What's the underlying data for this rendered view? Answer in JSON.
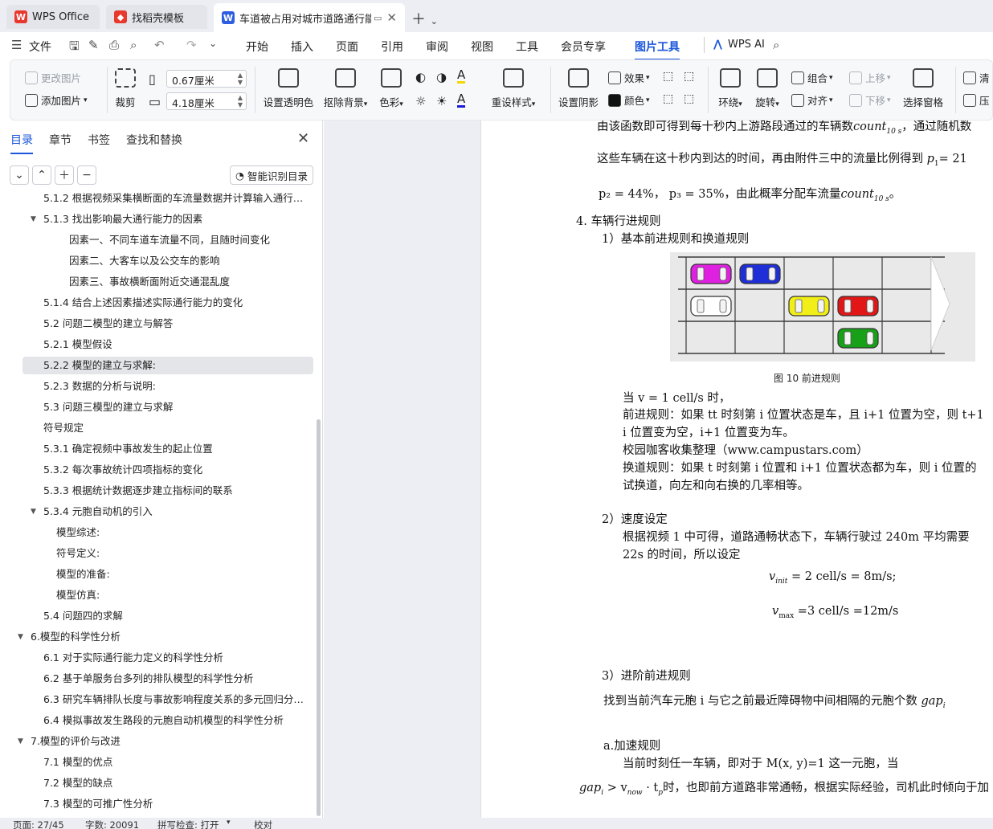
{
  "tabs": [
    {
      "label": "WPS Office",
      "icon": "wps-logo-icon",
      "color": "#e8392f"
    },
    {
      "label": "找稻壳模板",
      "icon": "docer-icon",
      "color": "#e8392f"
    },
    {
      "label": "车道被占用对城市道路通行能",
      "icon": "writer-doc-icon",
      "color": "#2f5fe0"
    }
  ],
  "menu": {
    "file": "文件",
    "items": [
      "开始",
      "插入",
      "页面",
      "引用",
      "审阅",
      "视图",
      "工具",
      "会员专享",
      "图片工具"
    ],
    "active": "图片工具",
    "wps_ai": "WPS AI"
  },
  "ribbon": {
    "change_image": "更改图片",
    "add_image": "添加图片",
    "crop": "裁剪",
    "width_value": "0.67厘米",
    "height_value": "4.18厘米",
    "set_transparent": "设置透明色",
    "remove_bg": "抠除背景",
    "color_tone": "色彩",
    "reset_style": "重设样式",
    "set_shadow": "设置阴影",
    "effects": "效果",
    "color": "颜色",
    "wrap": "环绕",
    "rotate": "旋转",
    "group": "组合",
    "align": "对齐",
    "move_up": "上移",
    "move_down": "下移",
    "select_pane": "选择窗格",
    "clear": "清",
    "compress": "压"
  },
  "sidebar": {
    "tabs": [
      "目录",
      "章节",
      "书签",
      "查找和替换"
    ],
    "smart_toc": "智能识别目录",
    "toc": [
      {
        "text": "5.1.2  根据视频采集横断面的车流量数据并计算输入通行能...",
        "level": 2,
        "caret": ""
      },
      {
        "text": "5.1.3  找出影响最大通行能力的因素",
        "level": 2,
        "caret": "open"
      },
      {
        "text": "因素一、不同车道车流量不同，且随时间变化",
        "level": 4,
        "caret": ""
      },
      {
        "text": "因素二、大客车以及公交车的影响",
        "level": 4,
        "caret": ""
      },
      {
        "text": "因素三、事故横断面附近交通混乱度",
        "level": 4,
        "caret": ""
      },
      {
        "text": "5.1.4  结合上述因素描述实际通行能力的变化",
        "level": 2,
        "caret": ""
      },
      {
        "text": "5.2  问题二模型的建立与解答",
        "level": 2,
        "caret": ""
      },
      {
        "text": "5.2.1  模型假设",
        "level": 2,
        "caret": ""
      },
      {
        "text": "5.2.2  模型的建立与求解:",
        "level": 2,
        "caret": "",
        "selected": true
      },
      {
        "text": "5.2.3 数据的分析与说明:",
        "level": 2,
        "caret": ""
      },
      {
        "text": "5.3  问题三模型的建立与求解",
        "level": 2,
        "caret": ""
      },
      {
        "text": "符号规定",
        "level": 2,
        "caret": ""
      },
      {
        "text": "5.3.1  确定视频中事故发生的起止位置",
        "level": 2,
        "caret": ""
      },
      {
        "text": "5.3.2  每次事故统计四项指标的变化",
        "level": 2,
        "caret": ""
      },
      {
        "text": "5.3.3  根据统计数据逐步建立指标间的联系",
        "level": 2,
        "caret": ""
      },
      {
        "text": "5.3.4  元胞自动机的引入",
        "level": 2,
        "caret": "open"
      },
      {
        "text": "模型综述:",
        "level": 3,
        "caret": ""
      },
      {
        "text": "符号定义:",
        "level": 3,
        "caret": ""
      },
      {
        "text": "模型的准备:",
        "level": 3,
        "caret": ""
      },
      {
        "text": "模型仿真:",
        "level": 3,
        "caret": ""
      },
      {
        "text": "5.4  问题四的求解",
        "level": 2,
        "caret": ""
      },
      {
        "text": "6.模型的科学性分析",
        "level": 1,
        "caret": "open"
      },
      {
        "text": "6.1 对于实际通行能力定义的科学性分析",
        "level": 2,
        "caret": ""
      },
      {
        "text": "6.2  基于单服务台多列的排队模型的科学性分析",
        "level": 2,
        "caret": ""
      },
      {
        "text": "6.3  研究车辆排队长度与事故影响程度关系的多元回归分析 ...",
        "level": 2,
        "caret": ""
      },
      {
        "text": "6.4 模拟事故发生路段的元胞自动机模型的科学性分析",
        "level": 2,
        "caret": ""
      },
      {
        "text": "7.模型的评价与改进",
        "level": 1,
        "caret": "open"
      },
      {
        "text": "7.1  模型的优点",
        "level": 2,
        "caret": ""
      },
      {
        "text": "7.2  模型的缺点",
        "level": 2,
        "caret": ""
      },
      {
        "text": "7.3  模型的可推广性分析",
        "level": 2,
        "caret": ""
      }
    ]
  },
  "doc": {
    "l1a": "由该函数即可得到每十秒内上游路段通过的车辆数",
    "l1b": "count",
    "l1c": "10 s",
    "l1d": "，通过随机数",
    "l2a": "这些车辆在这十秒内到达的时间，再由附件三中的流量比例得到",
    "l2b": "p",
    "l2c": "1",
    "l2d": "= 21",
    "l3": "p₂ = 44%，  p₃ = 35%，由此概率分配车流量",
    "l3b": "count",
    "l3c": "10 s",
    "l3d": "。",
    "h4": "4.   车辆行进规则",
    "h4_1": "1）基本前进规则和换道规则",
    "fig_caption": "图  10  前进规则",
    "p1": "当 v = 1 cell/s  时，",
    "p2": "前进规则：如果 tt 时刻第 i 位置状态是车，且 i+1 位置为空，则 t+1",
    "p3": "i 位置变为空，i+1 位置变为车。",
    "p4": "校园咖客收集整理（www.campustars.com）",
    "p5": "换道规则：如果 t 时刻第 i 位置和 i+1 位置状态都为车，则 i 位置的",
    "p6": "试换道，向左和向右换的几率相等。",
    "h4_2": "2）速度设定",
    "p7": "根据视频 1 中可得，道路通畅状态下，车辆行驶过 240m 平均需要",
    "p8": "22s 的时间，所以设定",
    "eq1a": "v",
    "eq1b": "init",
    "eq1c": " = 2 cell/s = 8m/s;",
    "eq2a": "v",
    "eq2b": "max",
    "eq2c": " =3  cell/s =12m/s",
    "h4_3": "3）进阶前进规则",
    "p9": "找到当前汽车元胞 i 与它之前最近障碍物中间相隔的元胞个数",
    "p9b": "gap",
    "p9c": "i",
    "p10": "a.加速规则",
    "p11": "当前时刻任一车辆，即对于 M(x, y)=1 这一元胞，当",
    "p12a": "gap",
    "p12b": "i",
    "p12c": " > v",
    "p12d": "now",
    "p12e": " · t",
    "p12f": "p",
    "p12g": "时，也即前方道路非常通畅，根据实际经验，司机此时倾向于加"
  },
  "figure": {
    "cars": [
      {
        "lane": 0,
        "cell": 0,
        "color": "#e020e0"
      },
      {
        "lane": 0,
        "cell": 1,
        "color": "#1f2fd8"
      },
      {
        "lane": 1,
        "cell": 0,
        "color": "#ffffff"
      },
      {
        "lane": 1,
        "cell": 2,
        "color": "#f2ee18"
      },
      {
        "lane": 1,
        "cell": 3,
        "color": "#e21616"
      },
      {
        "lane": 2,
        "cell": 3,
        "color": "#18a018"
      }
    ]
  },
  "status": {
    "page": "页面: 27/45",
    "words": "字数: 20091",
    "spell": "拼写检查: 打开",
    "proof": "校对"
  }
}
